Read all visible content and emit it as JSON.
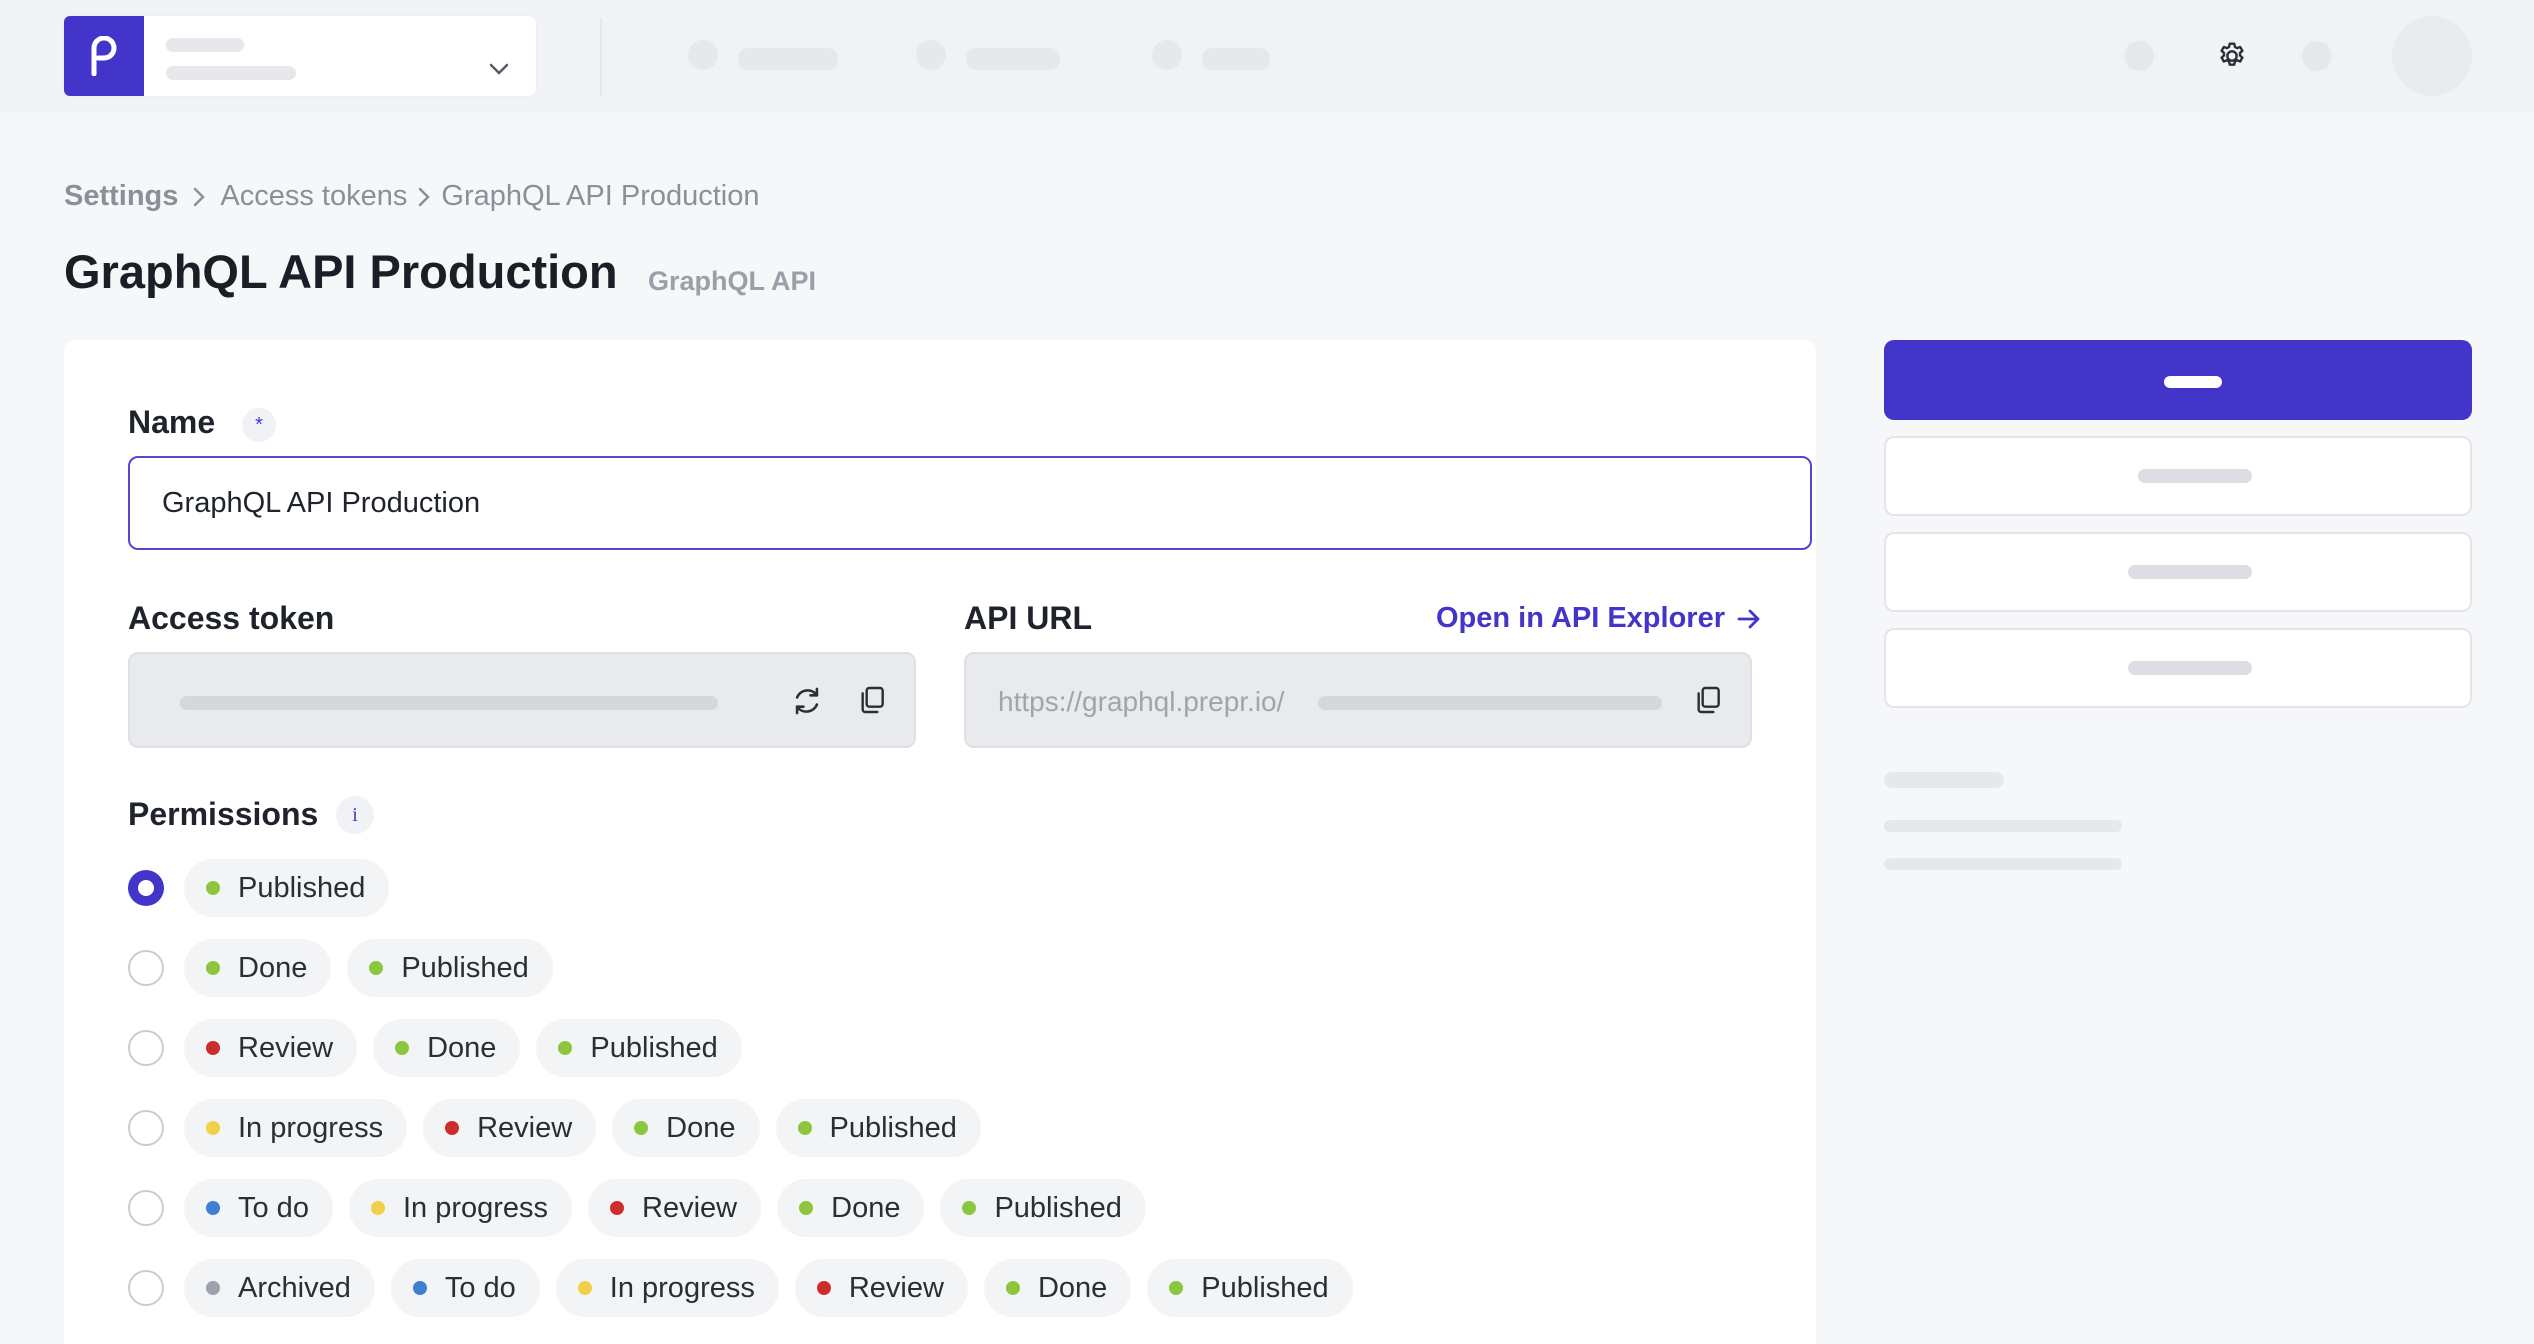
{
  "header": {
    "logo_icon": "brand-logo-icon",
    "settings_icon": "gear-icon"
  },
  "breadcrumb": {
    "items": [
      "Settings",
      "Access tokens",
      "GraphQL API Production"
    ]
  },
  "page": {
    "title": "GraphQL API Production",
    "type_label": "GraphQL API"
  },
  "form": {
    "name_label": "Name",
    "name_required_mark": "*",
    "name_value": "GraphQL API Production",
    "access_token_label": "Access token",
    "api_url_label": "API URL",
    "api_url_prefix": "https://graphql.prepr.io/",
    "open_explorer_label": "Open in API Explorer",
    "permissions_label": "Permissions",
    "permissions_info": "i"
  },
  "status_colors": {
    "Published": "#8cc63f",
    "Done": "#8cc63f",
    "Review": "#cc2e2e",
    "In progress": "#f0d04a",
    "To do": "#3d7fd0",
    "Archived": "#9ea2aa"
  },
  "permissions": [
    {
      "selected": true,
      "statuses": [
        "Published"
      ]
    },
    {
      "selected": false,
      "statuses": [
        "Done",
        "Published"
      ]
    },
    {
      "selected": false,
      "statuses": [
        "Review",
        "Done",
        "Published"
      ]
    },
    {
      "selected": false,
      "statuses": [
        "In progress",
        "Review",
        "Done",
        "Published"
      ]
    },
    {
      "selected": false,
      "statuses": [
        "To do",
        "In progress",
        "Review",
        "Done",
        "Published"
      ]
    },
    {
      "selected": false,
      "statuses": [
        "Archived",
        "To do",
        "In progress",
        "Review",
        "Done",
        "Published"
      ]
    }
  ],
  "colors": {
    "accent": "#4335c9"
  }
}
